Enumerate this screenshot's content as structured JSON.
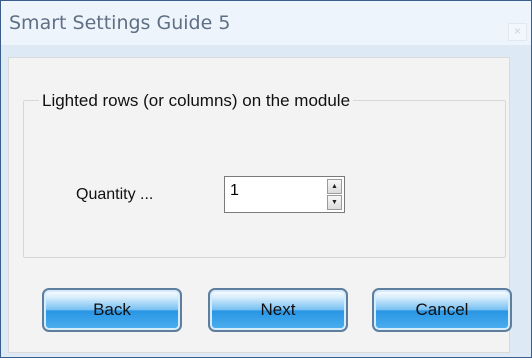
{
  "window": {
    "title": "Smart Settings Guide 5",
    "close_glyph": "×"
  },
  "group": {
    "legend": "Lighted rows (or columns) on the module"
  },
  "quantity": {
    "label": "Quantity ...",
    "value": "1",
    "up_glyph": "▲",
    "down_glyph": "▼"
  },
  "buttons": {
    "back": "Back",
    "next": "Next",
    "cancel": "Cancel"
  },
  "colors": {
    "title_bar": "#eef4fb",
    "frame": "#dde9f5",
    "panel": "#f3f3f3",
    "button_blue": "#2895e4"
  }
}
